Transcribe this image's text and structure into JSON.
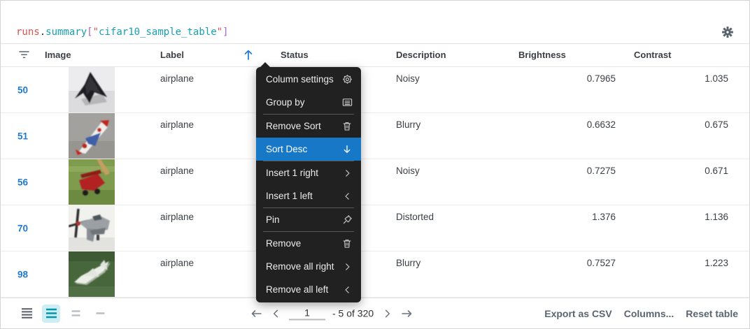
{
  "title_code": {
    "t1": "runs",
    "t2": ".",
    "t3": "summary",
    "t4": "[",
    "t5": "\"",
    "t6": "cifar10_sample_table",
    "t7": "\"",
    "t8": "]"
  },
  "colors": {
    "link_blue": "#1f7bce",
    "menu_highlight_blue": "#1878c8",
    "menu_bg": "#212121",
    "selected_density_teal": "#0097ab",
    "code_red": "#d9534f",
    "code_teal": "#189fae",
    "code_magenta": "#b05fc9"
  },
  "table": {
    "headers": [
      "Image",
      "Label",
      "Status",
      "Description",
      "Brightness",
      "Contrast"
    ],
    "sort": {
      "column": "Label",
      "direction": "asc"
    },
    "rows": [
      {
        "index": "50",
        "label": "airplane",
        "description": "Noisy",
        "brightness": "0.7965",
        "contrast": "1.035",
        "image_alt": "black stealth jet on light background"
      },
      {
        "index": "51",
        "label": "airplane",
        "description": "Blurry",
        "brightness": "0.6632",
        "contrast": "0.675",
        "image_alt": "red white and blue toy jet on gray"
      },
      {
        "index": "56",
        "label": "airplane",
        "description": "Noisy",
        "brightness": "0.7275",
        "contrast": "0.671",
        "image_alt": "red biplane on grass"
      },
      {
        "index": "70",
        "label": "airplane",
        "description": "Distorted",
        "brightness": "1.376",
        "contrast": "1.136",
        "image_alt": "gray propeller plane on white"
      },
      {
        "index": "98",
        "label": "airplane",
        "description": "Blurry",
        "brightness": "0.7527",
        "contrast": "1.223",
        "image_alt": "white jet over green field"
      }
    ]
  },
  "menu": {
    "items": [
      {
        "label": "Column settings",
        "icon": "gear-icon"
      },
      {
        "label": "Group by",
        "icon": "group-icon"
      },
      {
        "label": "Remove Sort",
        "icon": "trash-icon"
      },
      {
        "label": "Sort Desc",
        "icon": "arrow-down-icon",
        "highlighted": true
      },
      {
        "label": "Insert 1 right",
        "icon": "chevron-right-icon"
      },
      {
        "label": "Insert 1 left",
        "icon": "chevron-left-icon"
      },
      {
        "label": "Pin",
        "icon": "pin-icon"
      },
      {
        "label": "Remove",
        "icon": "trash-icon"
      },
      {
        "label": "Remove all right",
        "icon": "chevron-right-icon"
      },
      {
        "label": "Remove all left",
        "icon": "chevron-left-icon"
      }
    ]
  },
  "footer": {
    "pagination": {
      "page_value": "1",
      "range_label": "- 5 of 320"
    },
    "actions": {
      "export": "Export as CSV",
      "columns": "Columns...",
      "reset": "Reset table"
    }
  }
}
